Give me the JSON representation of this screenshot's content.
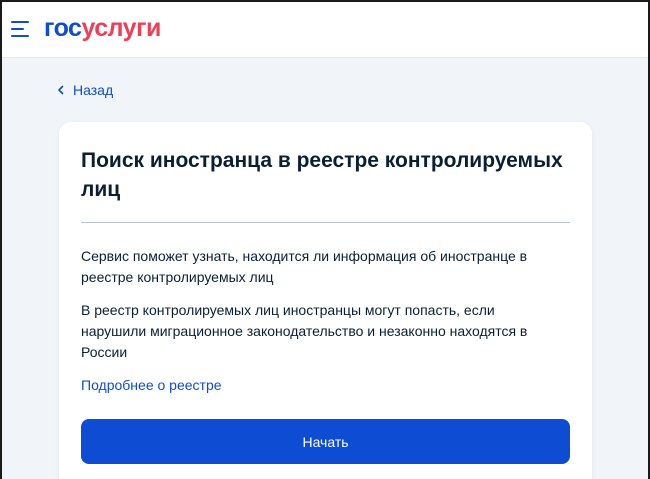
{
  "header": {
    "logo_part1": "гос",
    "logo_part2": "услуги",
    "menu_icon": "hamburger-menu-icon"
  },
  "nav": {
    "back_label": "Назад",
    "back_icon": "chevron-left-icon"
  },
  "card": {
    "title": "Поиск иностранца в реестре контролируемых лиц",
    "paragraph1": "Сервис поможет узнать, находится ли информация об иностранце в реестре контролируемых лиц",
    "paragraph2": "В реестр контролируемых лиц иностранцы могут попасть, если нарушили миграционное законодательство и незаконно находятся в России",
    "more_link": "Подробнее о реестре",
    "start_button": "Начать"
  },
  "colors": {
    "brand_blue": "#0d4cd3",
    "brand_red": "#ee3f58",
    "text_dark": "#0b1f33",
    "page_bg": "#f1f5f9"
  }
}
